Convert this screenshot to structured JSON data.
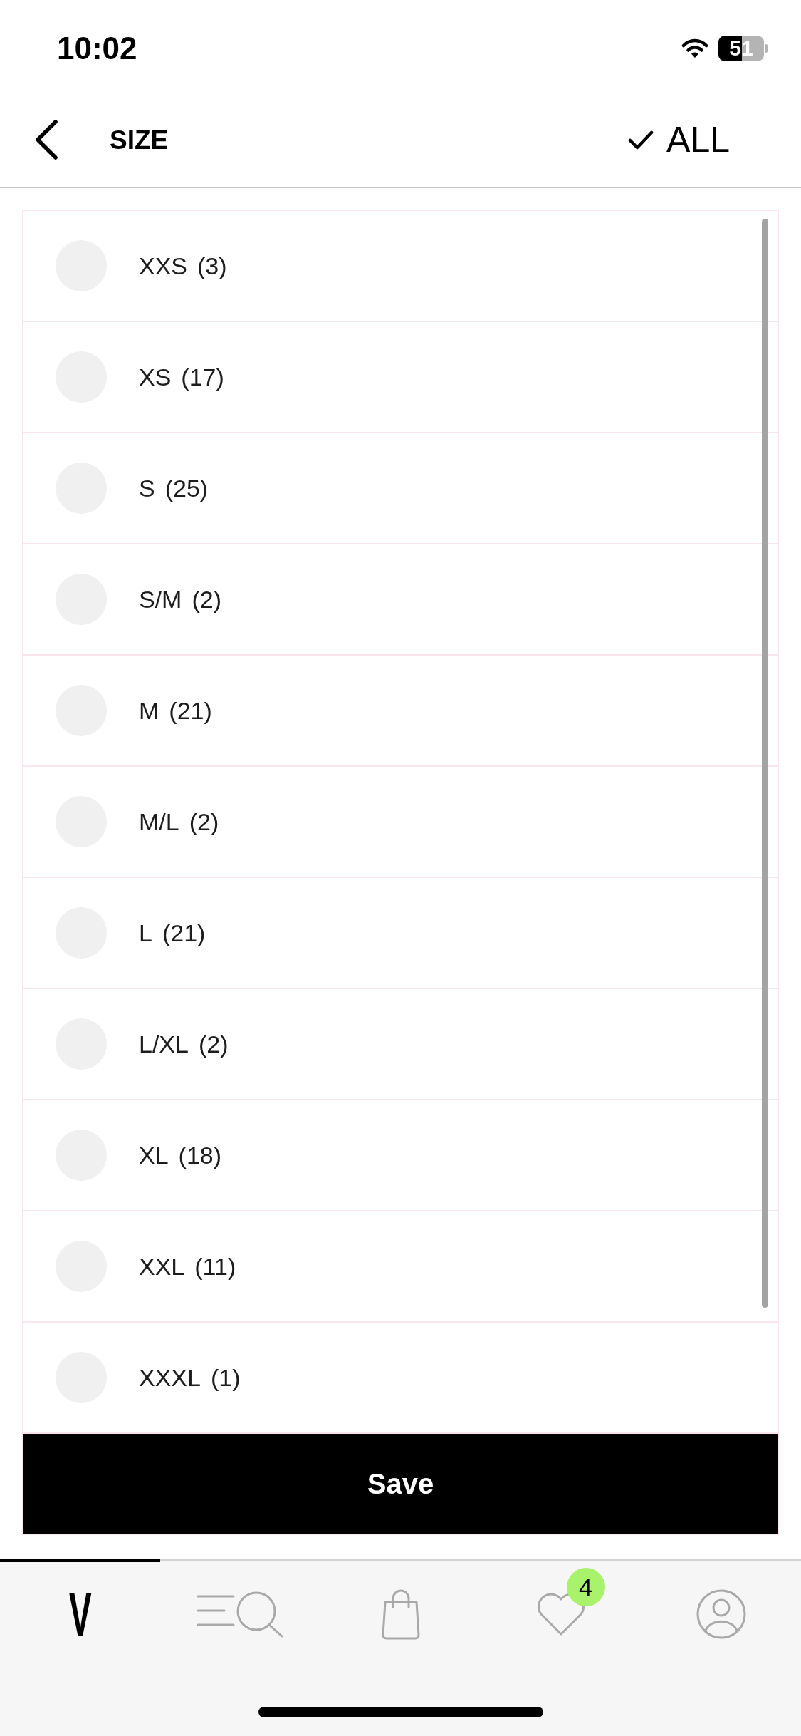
{
  "status_bar": {
    "time": "10:02",
    "battery": "51"
  },
  "header": {
    "title": "SIZE",
    "select_all": "ALL"
  },
  "sizes": [
    {
      "size": "XXS",
      "count": "(3)",
      "selected": false
    },
    {
      "size": "XS",
      "count": "(17)",
      "selected": false
    },
    {
      "size": "S",
      "count": "(25)",
      "selected": false
    },
    {
      "size": "S/M",
      "count": "(2)",
      "selected": false
    },
    {
      "size": "M",
      "count": "(21)",
      "selected": false
    },
    {
      "size": "M/L",
      "count": "(2)",
      "selected": false
    },
    {
      "size": "L",
      "count": "(21)",
      "selected": false
    },
    {
      "size": "L/XL",
      "count": "(2)",
      "selected": false
    },
    {
      "size": "XL",
      "count": "(18)",
      "selected": false
    },
    {
      "size": "XXL",
      "count": "(11)",
      "selected": false
    },
    {
      "size": "XXXL",
      "count": "(1)",
      "selected": false
    }
  ],
  "save_button": "Save",
  "tab_bar": {
    "tabs": [
      {
        "kind": "logo",
        "label": "V",
        "selected": true
      },
      {
        "kind": "search",
        "selected": false
      },
      {
        "kind": "bag",
        "selected": false
      },
      {
        "kind": "wishlist",
        "badge": "4",
        "selected": false
      },
      {
        "kind": "account",
        "selected": false
      }
    ]
  }
}
